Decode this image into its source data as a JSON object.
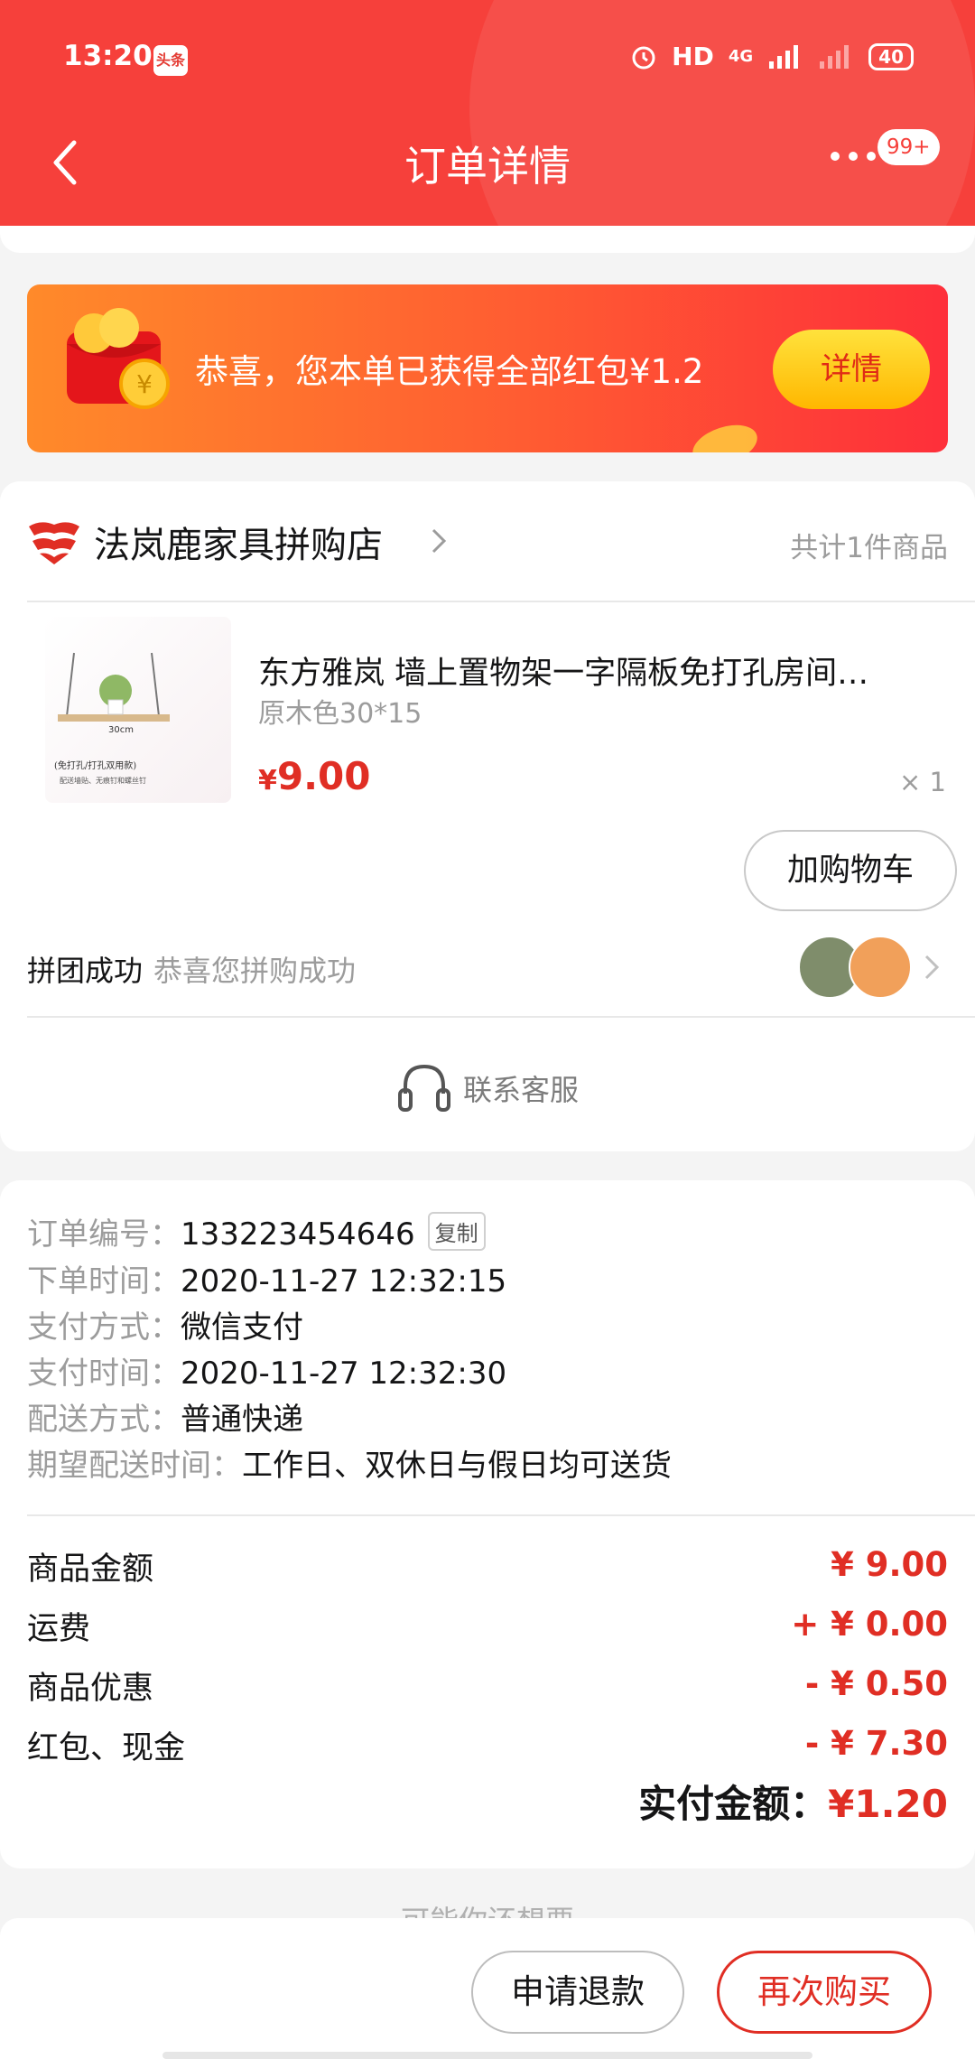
{
  "status_bar": {
    "time": "13:20",
    "app_badge": "头条",
    "network": "HD",
    "signal": "4G",
    "battery": "40"
  },
  "header": {
    "title": "订单详情",
    "notification_count": "99+"
  },
  "banner": {
    "text": "恭喜，您本单已获得全部红包¥1.2",
    "button": "详情"
  },
  "shop": {
    "name": "法岚鹿家具拼购店",
    "item_count": "共计1件商品"
  },
  "product": {
    "title": "东方雅岚 墙上置物架一字隔板免打孔房间…",
    "spec": "原木色30*15",
    "price_symbol": "¥",
    "price": "9.00",
    "quantity": "× 1",
    "cart_button": "加购物车"
  },
  "group": {
    "label": "拼团成功",
    "sub": "恭喜您拼购成功"
  },
  "service": {
    "label": "联系客服"
  },
  "order_info": {
    "order_no_label": "订单编号：",
    "order_no": "133223454646",
    "copy": "复制",
    "order_time_label": "下单时间：",
    "order_time": "2020-11-27 12:32:15",
    "pay_method_label": "支付方式：",
    "pay_method": "微信支付",
    "pay_time_label": "支付时间：",
    "pay_time": "2020-11-27 12:32:30",
    "delivery_label": "配送方式：",
    "delivery": "普通快递",
    "expect_label": "期望配送时间：",
    "expect": "工作日、双休日与假日均可送货"
  },
  "amounts": {
    "goods_label": "商品金额",
    "goods": "¥ 9.00",
    "shipping_label": "运费",
    "shipping": "+ ¥ 0.00",
    "discount_label": "商品优惠",
    "discount": "- ¥ 0.50",
    "redpack_label": "红包、现金",
    "redpack": "- ¥ 7.30",
    "total_label": "实付金额：",
    "total": "¥1.20"
  },
  "peek": "可能你还想要",
  "actions": {
    "refund": "申请退款",
    "rebuy": "再次购买"
  },
  "colors": {
    "brand_red": "#f6403b",
    "price_red": "#e02e24",
    "muted": "#9c9c9c"
  }
}
